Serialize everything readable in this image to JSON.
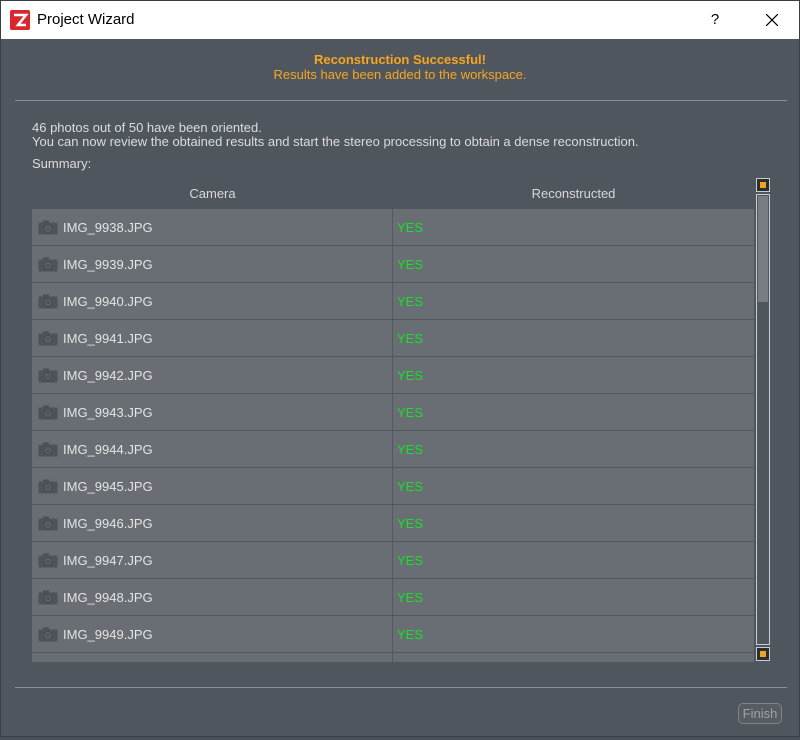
{
  "window": {
    "title": "Project Wizard",
    "help_label": "?"
  },
  "banner": {
    "title": "Reconstruction Successful!",
    "subtitle": "Results have been added to the workspace.",
    "color": "#f5a623"
  },
  "info": {
    "line1": "46 photos out of 50 have been oriented.",
    "line2": "You can now review the obtained results and start the stereo processing to obtain a dense reconstruction.",
    "summary_label": "Summary:"
  },
  "table": {
    "headers": {
      "camera": "Camera",
      "reconstructed": "Reconstructed"
    },
    "rows": [
      {
        "camera": "IMG_9938.JPG",
        "reconstructed": "YES"
      },
      {
        "camera": "IMG_9939.JPG",
        "reconstructed": "YES"
      },
      {
        "camera": "IMG_9940.JPG",
        "reconstructed": "YES"
      },
      {
        "camera": "IMG_9941.JPG",
        "reconstructed": "YES"
      },
      {
        "camera": "IMG_9942.JPG",
        "reconstructed": "YES"
      },
      {
        "camera": "IMG_9943.JPG",
        "reconstructed": "YES"
      },
      {
        "camera": "IMG_9944.JPG",
        "reconstructed": "YES"
      },
      {
        "camera": "IMG_9945.JPG",
        "reconstructed": "YES"
      },
      {
        "camera": "IMG_9946.JPG",
        "reconstructed": "YES"
      },
      {
        "camera": "IMG_9947.JPG",
        "reconstructed": "YES"
      },
      {
        "camera": "IMG_9948.JPG",
        "reconstructed": "YES"
      },
      {
        "camera": "IMG_9949.JPG",
        "reconstructed": "YES"
      },
      {
        "camera": "",
        "reconstructed": ""
      }
    ],
    "status_color": "#18e02a",
    "row_icon": "camera-icon"
  },
  "footer": {
    "finish_label": "Finish"
  },
  "icons": {
    "app": "zephyr-logo-icon",
    "close": "close-icon",
    "help": "help-icon"
  }
}
